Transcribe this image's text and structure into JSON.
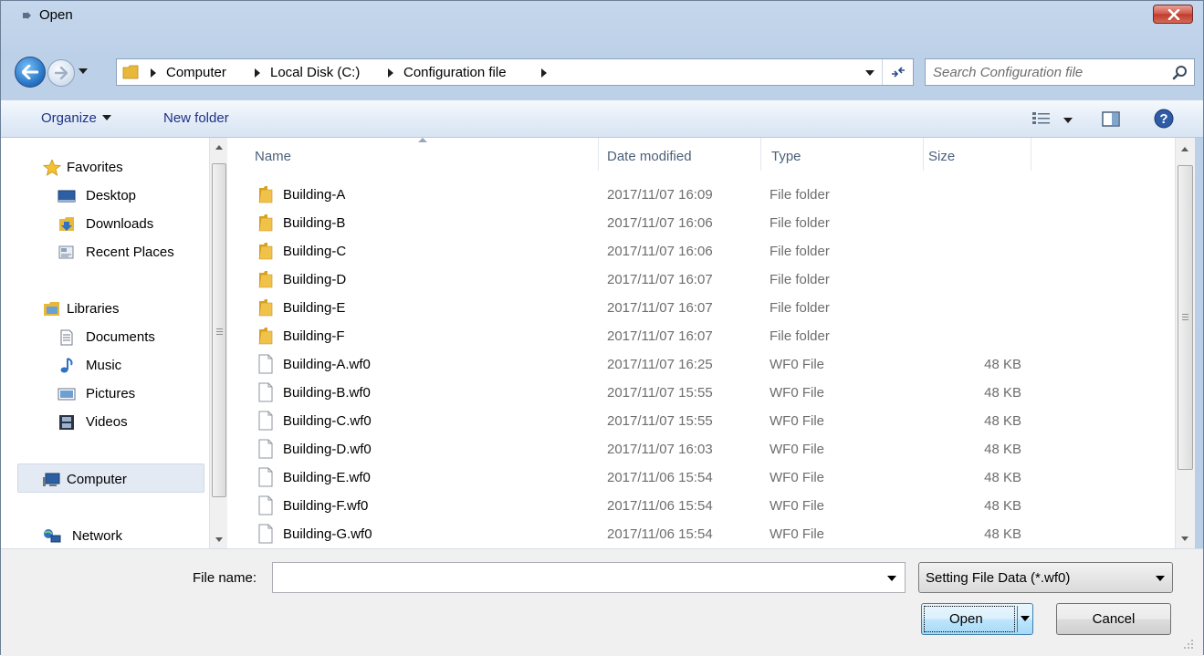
{
  "window": {
    "title": "Open"
  },
  "address": {
    "crumbs": [
      "Computer",
      "Local Disk (C:)",
      "Configuration file"
    ]
  },
  "search": {
    "placeholder": "Search Configuration file"
  },
  "toolbar": {
    "organize_label": "Organize",
    "new_folder_label": "New folder"
  },
  "navpane": {
    "favorites": "Favorites",
    "desktop": "Desktop",
    "downloads": "Downloads",
    "recent": "Recent Places",
    "libraries": "Libraries",
    "documents": "Documents",
    "music": "Music",
    "pictures": "Pictures",
    "videos": "Videos",
    "computer": "Computer",
    "network": "Network"
  },
  "columns": {
    "name": "Name",
    "date": "Date modified",
    "type": "Type",
    "size": "Size"
  },
  "files": [
    {
      "name": "Building-A",
      "date": "2017/11/07 16:09",
      "type": "File folder",
      "size": "",
      "icon": "folder-icon"
    },
    {
      "name": "Building-B",
      "date": "2017/11/07 16:06",
      "type": "File folder",
      "size": "",
      "icon": "folder-icon"
    },
    {
      "name": "Building-C",
      "date": "2017/11/07 16:06",
      "type": "File folder",
      "size": "",
      "icon": "folder-icon"
    },
    {
      "name": "Building-D",
      "date": "2017/11/07 16:07",
      "type": "File folder",
      "size": "",
      "icon": "folder-icon"
    },
    {
      "name": "Building-E",
      "date": "2017/11/07 16:07",
      "type": "File folder",
      "size": "",
      "icon": "folder-icon"
    },
    {
      "name": "Building-F",
      "date": "2017/11/07 16:07",
      "type": "File folder",
      "size": "",
      "icon": "folder-icon"
    },
    {
      "name": "Building-A.wf0",
      "date": "2017/11/07 16:25",
      "type": "WF0 File",
      "size": "48 KB",
      "icon": "file-icon"
    },
    {
      "name": "Building-B.wf0",
      "date": "2017/11/07 15:55",
      "type": "WF0 File",
      "size": "48 KB",
      "icon": "file-icon"
    },
    {
      "name": "Building-C.wf0",
      "date": "2017/11/07 15:55",
      "type": "WF0 File",
      "size": "48 KB",
      "icon": "file-icon"
    },
    {
      "name": "Building-D.wf0",
      "date": "2017/11/07 16:03",
      "type": "WF0 File",
      "size": "48 KB",
      "icon": "file-icon"
    },
    {
      "name": "Building-E.wf0",
      "date": "2017/11/06 15:54",
      "type": "WF0 File",
      "size": "48 KB",
      "icon": "file-icon"
    },
    {
      "name": "Building-F.wf0",
      "date": "2017/11/06 15:54",
      "type": "WF0 File",
      "size": "48 KB",
      "icon": "file-icon"
    },
    {
      "name": "Building-G.wf0",
      "date": "2017/11/06 15:54",
      "type": "WF0 File",
      "size": "48 KB",
      "icon": "file-icon"
    }
  ],
  "bottom": {
    "filename_label": "File name:",
    "filename_value": "",
    "filter_value": "Setting File Data (*.wf0)",
    "open_label": "Open",
    "cancel_label": "Cancel"
  },
  "colors": {
    "accent": "#1e3287",
    "selection": "#e3eaf3",
    "folder": "#e8b83a"
  }
}
